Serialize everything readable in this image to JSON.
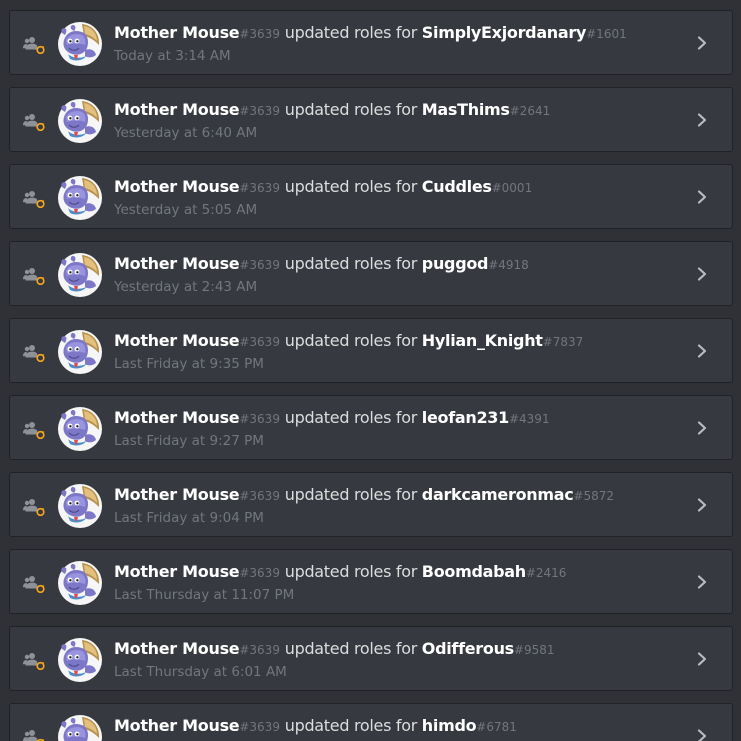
{
  "audit_log": {
    "entries": [
      {
        "actor": "Mother Mouse",
        "actor_disc": "#3639",
        "action": "updated roles for",
        "target": "SimplyExjordanary",
        "target_disc": "#1601",
        "time": "Today at 3:14 AM"
      },
      {
        "actor": "Mother Mouse",
        "actor_disc": "#3639",
        "action": "updated roles for",
        "target": "MasThims",
        "target_disc": "#2641",
        "time": "Yesterday at 6:40 AM"
      },
      {
        "actor": "Mother Mouse",
        "actor_disc": "#3639",
        "action": "updated roles for",
        "target": "Cuddles",
        "target_disc": "#0001",
        "time": "Yesterday at 5:05 AM"
      },
      {
        "actor": "Mother Mouse",
        "actor_disc": "#3639",
        "action": "updated roles for",
        "target": "puggod",
        "target_disc": "#4918",
        "time": "Yesterday at 2:43 AM"
      },
      {
        "actor": "Mother Mouse",
        "actor_disc": "#3639",
        "action": "updated roles for",
        "target": "Hylian_Knight",
        "target_disc": "#7837",
        "time": "Last Friday at 9:35 PM"
      },
      {
        "actor": "Mother Mouse",
        "actor_disc": "#3639",
        "action": "updated roles for",
        "target": "leofan231",
        "target_disc": "#4391",
        "time": "Last Friday at 9:27 PM"
      },
      {
        "actor": "Mother Mouse",
        "actor_disc": "#3639",
        "action": "updated roles for",
        "target": "darkcameronmac",
        "target_disc": "#5872",
        "time": "Last Friday at 9:04 PM"
      },
      {
        "actor": "Mother Mouse",
        "actor_disc": "#3639",
        "action": "updated roles for",
        "target": "Boomdabah",
        "target_disc": "#2416",
        "time": "Last Thursday at 11:07 PM"
      },
      {
        "actor": "Mother Mouse",
        "actor_disc": "#3639",
        "action": "updated roles for",
        "target": "Odifferous",
        "target_disc": "#9581",
        "time": "Last Thursday at 6:01 AM"
      },
      {
        "actor": "Mother Mouse",
        "actor_disc": "#3639",
        "action": "updated roles for",
        "target": "himdo",
        "target_disc": "#6781",
        "time": ""
      }
    ],
    "icons": {
      "action": "member-role-update-icon",
      "expand": "chevron-right-icon",
      "avatar": "mouse-character-avatar"
    },
    "colors": {
      "background": "#2f3136",
      "entry_background": "#36393f",
      "username": "#ffffff",
      "action_text": "#dcddde",
      "muted_text": "#72767d"
    }
  }
}
